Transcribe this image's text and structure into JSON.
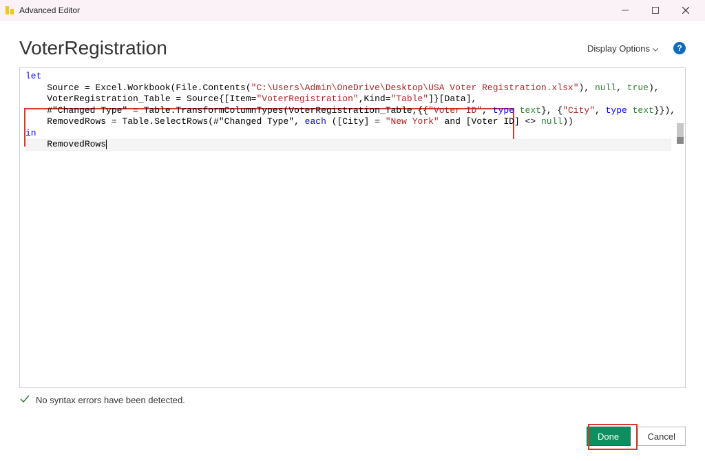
{
  "window": {
    "title": "Advanced Editor"
  },
  "header": {
    "query_name": "VoterRegistration",
    "display_options_label": "Display Options"
  },
  "code": {
    "line1_kw": "let",
    "line2_a": "    Source = Excel.Workbook(File.Contents(",
    "line2_str": "\"C:\\Users\\Admin\\OneDrive\\Desktop\\USA Voter Registration.xlsx\"",
    "line2_b": "), ",
    "line2_null": "null",
    "line2_c": ", ",
    "line2_true": "true",
    "line2_d": "),",
    "line3_a": "    VoterRegistration_Table = Source{[Item=",
    "line3_str1": "\"VoterRegistration\"",
    "line3_b": ",Kind=",
    "line3_str2": "\"Table\"",
    "line3_c": "]}[Data],",
    "line4_a": "    #\"Changed Type\" = Table.TransformColumnTypes(VoterRegistration_Table,{{",
    "line4_str1": "\"Voter ID\"",
    "line4_b": ", ",
    "line4_type1a": "type",
    "line4_type1b": " text",
    "line4_c": "}, {",
    "line4_str2": "\"City\"",
    "line4_d": ", ",
    "line4_type2a": "type",
    "line4_type2b": " text",
    "line4_e": "}}),",
    "line5_a": "    RemovedRows = Table.SelectRows(#\"Changed Type\", ",
    "line5_each": "each",
    "line5_b": " ([City] = ",
    "line5_str": "\"New York\"",
    "line5_c": " and [Voter ID] <> ",
    "line5_null": "null",
    "line5_d": "))",
    "line6_kw": "in",
    "line7": "    RemovedRows"
  },
  "status": {
    "message": "No syntax errors have been detected."
  },
  "buttons": {
    "done": "Done",
    "cancel": "Cancel"
  }
}
